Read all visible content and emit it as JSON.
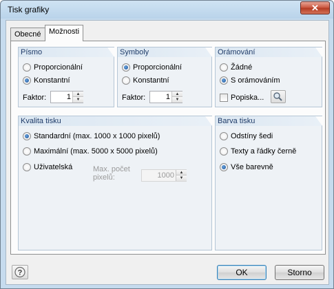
{
  "window": {
    "title": "Tisk grafiky",
    "close_glyph": "✕"
  },
  "tabs": [
    {
      "label": "Obecné",
      "active": false
    },
    {
      "label": "Možnosti",
      "active": true
    }
  ],
  "font_group": {
    "header": "Písmo",
    "options": [
      {
        "label": "Proporcionální",
        "checked": false
      },
      {
        "label": "Konstantní",
        "checked": true
      }
    ],
    "factor_label": "Faktor:",
    "factor_value": "1"
  },
  "symbols_group": {
    "header": "Symboly",
    "options": [
      {
        "label": "Proporcionální",
        "checked": true
      },
      {
        "label": "Konstantní",
        "checked": false
      }
    ],
    "factor_label": "Faktor:",
    "factor_value": "1"
  },
  "border_group": {
    "header": "Orámování",
    "options": [
      {
        "label": "Žádné",
        "checked": false
      },
      {
        "label": "S orámováním",
        "checked": true
      }
    ],
    "caption_label": "Popiska...",
    "caption_checked": false
  },
  "quality_group": {
    "header": "Kvalita tisku",
    "options": [
      {
        "label": "Standardní (max. 1000 x 1000 pixelů)",
        "checked": true
      },
      {
        "label": "Maximální (max. 5000 x 5000 pixelů)",
        "checked": false
      },
      {
        "label": "Uživatelská",
        "checked": false
      }
    ],
    "max_count_label_1": "Max. počet",
    "max_count_label_2": "pixelů:",
    "max_count_value": "1000"
  },
  "color_group": {
    "header": "Barva tisku",
    "options": [
      {
        "label": "Odstíny šedi",
        "checked": false
      },
      {
        "label": "Texty a řádky černě",
        "checked": false
      },
      {
        "label": "Vše barevně",
        "checked": true
      }
    ]
  },
  "footer": {
    "help_glyph": "?",
    "ok_label": "OK",
    "cancel_label": "Storno"
  }
}
